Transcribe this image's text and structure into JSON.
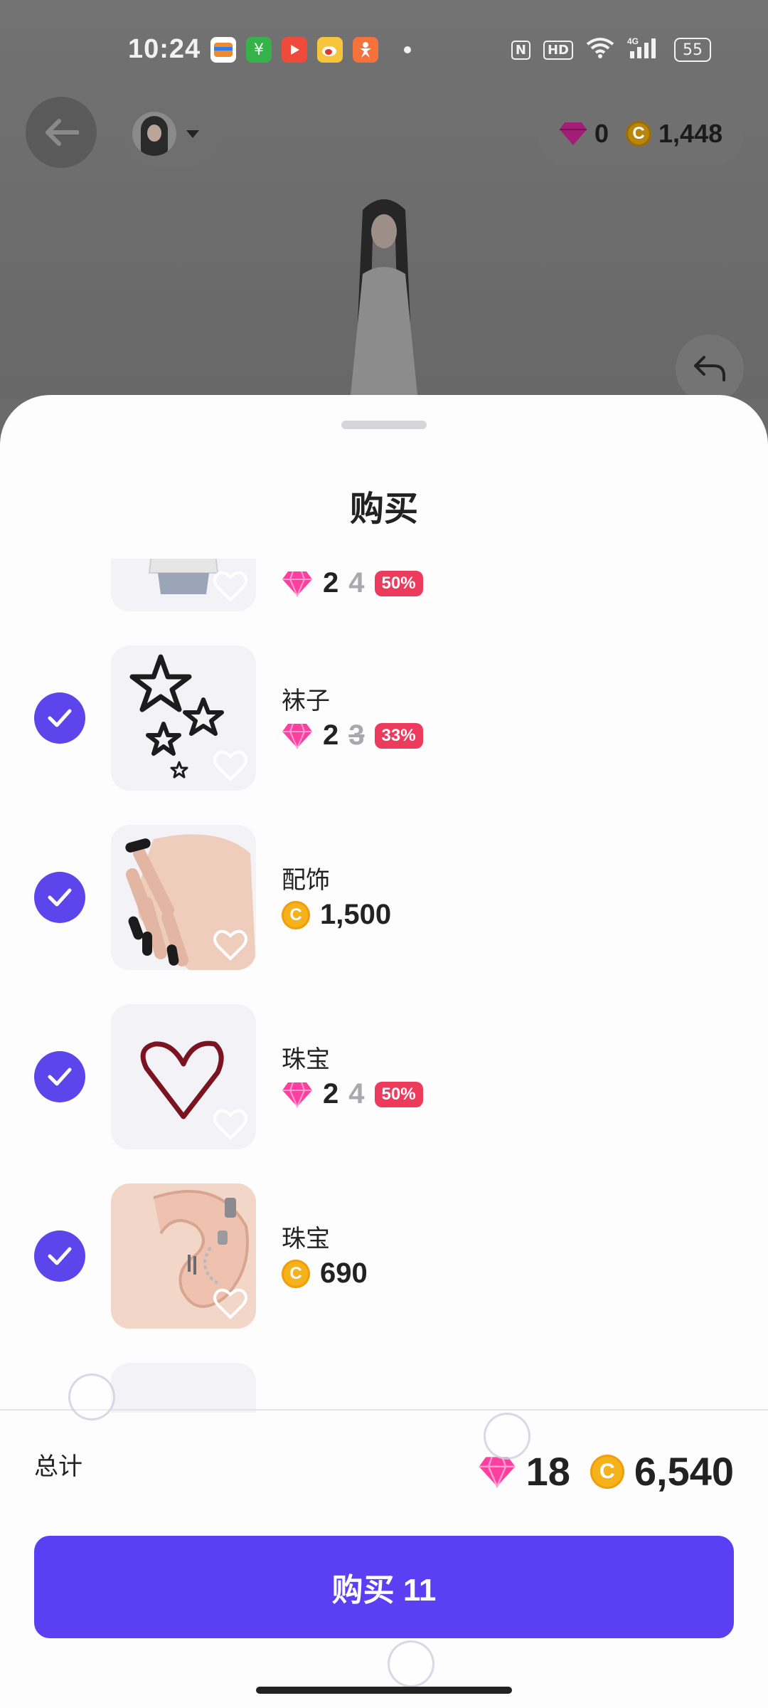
{
  "status_bar": {
    "time": "10:24",
    "battery": "55",
    "network": "4G"
  },
  "header": {
    "gems_balance": "0",
    "coins_balance": "1,448"
  },
  "sheet": {
    "title": "购买",
    "items": [
      {
        "name": "",
        "currency": "gem",
        "price": "2",
        "old_price": "4",
        "discount": "50%",
        "thumb": "dress-icon",
        "strike": false
      },
      {
        "name": "袜子",
        "currency": "gem",
        "price": "2",
        "old_price": "3",
        "discount": "33%",
        "thumb": "stars-icon",
        "strike": true
      },
      {
        "name": "配饰",
        "currency": "coin",
        "price": "1,500",
        "old_price": "",
        "discount": "",
        "thumb": "nails-icon",
        "strike": false
      },
      {
        "name": "珠宝",
        "currency": "gem",
        "price": "2",
        "old_price": "4",
        "discount": "50%",
        "thumb": "heart-jewel-icon",
        "strike": false
      },
      {
        "name": "珠宝",
        "currency": "coin",
        "price": "690",
        "old_price": "",
        "discount": "",
        "thumb": "earring-icon",
        "strike": false
      }
    ],
    "total_label": "总计",
    "total_gems": "18",
    "total_coins": "6,540",
    "buy_button": "购买 11"
  },
  "colors": {
    "accent": "#5b3ff3",
    "check": "#5c45ea",
    "discount_badge": "#ec3b5c",
    "coin": "#f6b21a",
    "gem": "#ff3fa0"
  }
}
